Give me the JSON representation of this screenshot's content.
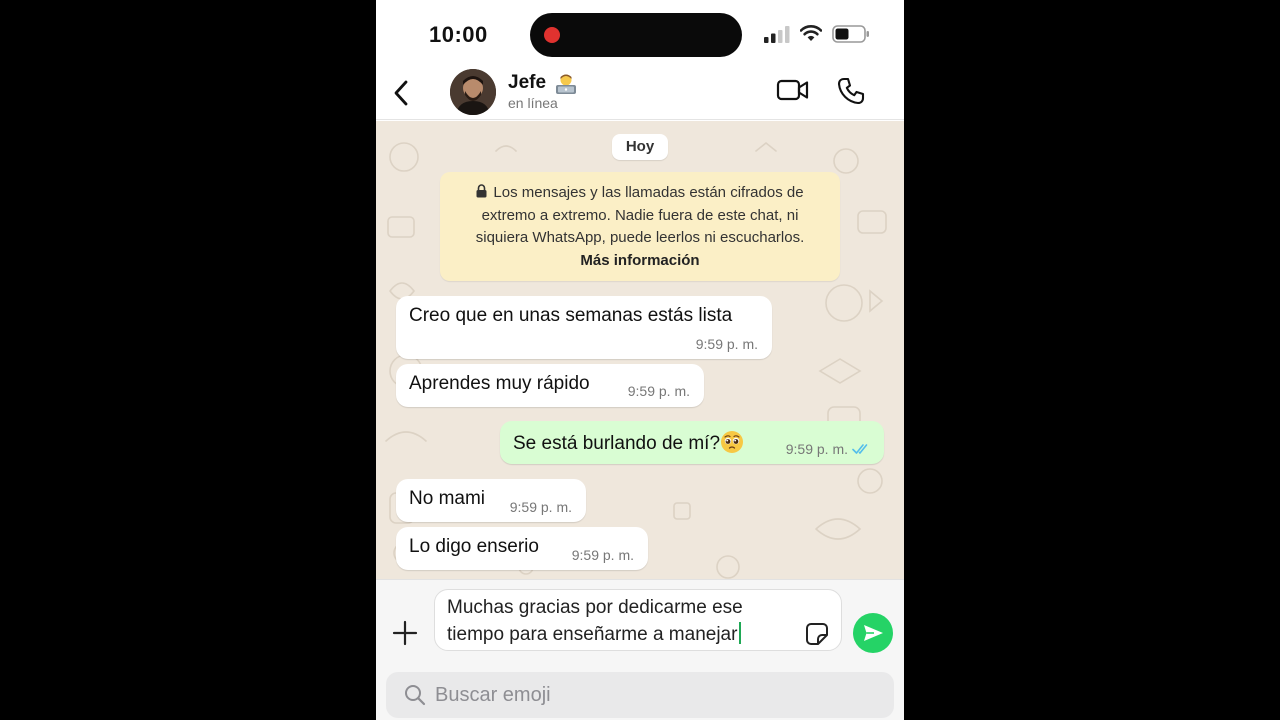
{
  "status_bar": {
    "time": "10:00",
    "signal_icon": "cellular-signal-icon",
    "wifi_icon": "wifi-icon",
    "battery_icon": "battery-icon",
    "recording_indicator_color": "#e0322f"
  },
  "header": {
    "back_icon": "chevron-left-icon",
    "contact_name": "Jefe",
    "contact_name_emoji": "technologist-emoji",
    "contact_status": "en línea",
    "video_call_icon": "video-camera-icon",
    "voice_call_icon": "phone-icon"
  },
  "chat": {
    "date_label": "Hoy",
    "encryption_notice": {
      "lines": [
        "Los mensajes y las llamadas están cifrados de",
        "extremo a extremo. Nadie fuera de este chat, ni",
        "siquiera WhatsApp, puede leerlos ni escucharlos."
      ],
      "link": "Más información",
      "icon": "lock-icon"
    },
    "messages": [
      {
        "direction": "incoming",
        "text": "Creo que en unas semanas estás lista",
        "time": "9:59 p. m."
      },
      {
        "direction": "incoming",
        "text": "Aprendes muy rápido",
        "time": "9:59 p. m."
      },
      {
        "direction": "outgoing",
        "text": "Se está burlando de mí?",
        "emoji": "pleading-face-emoji",
        "time": "9:59 p. m.",
        "status_icon": "double-check-read-icon"
      },
      {
        "direction": "incoming",
        "text": "No mami",
        "time": "9:59 p. m."
      },
      {
        "direction": "incoming",
        "text": "Lo digo enserio",
        "time": "9:59 p. m."
      }
    ]
  },
  "composer": {
    "add_icon": "plus-icon",
    "input_value": "Muchas gracias por dedicarme ese\ntiempo para enseñarme a manejar",
    "sticker_icon": "sticker-icon",
    "send_icon": "send-icon"
  },
  "emoji_search": {
    "placeholder": "Buscar emoji",
    "icon": "search-icon"
  },
  "colors": {
    "chat_background": "#efe7dc",
    "outgoing_bubble": "#d9fdd3",
    "incoming_bubble": "#ffffff",
    "encryption_notice": "#fbefc6",
    "send_button": "#25d366",
    "read_ticks": "#53bdeb"
  }
}
